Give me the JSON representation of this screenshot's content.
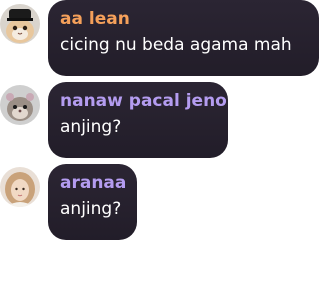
{
  "messages": [
    {
      "author": "aa lean",
      "text": "cicing nu beda agama mah",
      "name_color": "#f5a05a",
      "avatar": "cat-with-hat-avatar"
    },
    {
      "author": "nanaw pacal jeno",
      "text": "anjing?",
      "name_color": "#b49cf0",
      "avatar": "hamster-avatar"
    },
    {
      "author": "aranaa",
      "text": "anjing?",
      "name_color": "#b49cf0",
      "avatar": "person-avatar"
    }
  ]
}
